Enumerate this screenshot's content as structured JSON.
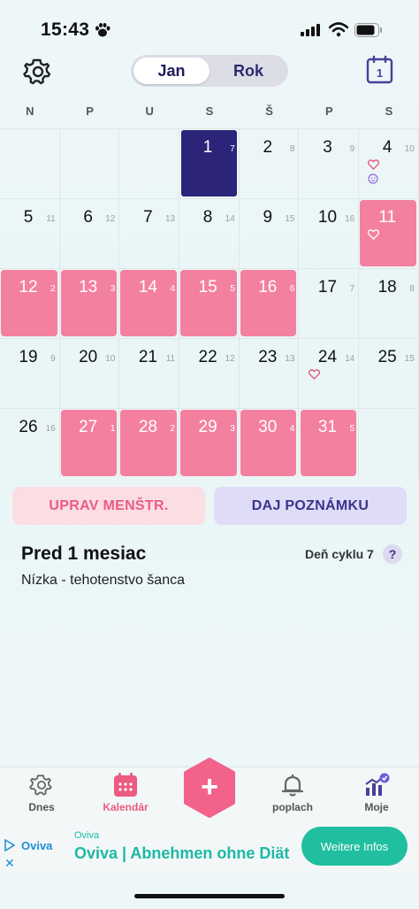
{
  "status_bar": {
    "time": "15:43"
  },
  "header": {
    "segments": [
      {
        "label": "Jan",
        "active": true
      },
      {
        "label": "Rok",
        "active": false
      }
    ]
  },
  "weekdays": [
    "N",
    "P",
    "U",
    "S",
    "Š",
    "P",
    "S"
  ],
  "calendar": {
    "days": [
      {
        "day": "",
        "cycle": "",
        "kind": "empty"
      },
      {
        "day": "",
        "cycle": "",
        "kind": "empty"
      },
      {
        "day": "",
        "cycle": "",
        "kind": "empty"
      },
      {
        "day": "1",
        "cycle": "7",
        "kind": "today"
      },
      {
        "day": "2",
        "cycle": "8",
        "kind": "normal"
      },
      {
        "day": "3",
        "cycle": "9",
        "kind": "normal"
      },
      {
        "day": "4",
        "cycle": "10",
        "kind": "normal",
        "marks": [
          "heart",
          "smiley"
        ]
      },
      {
        "day": "5",
        "cycle": "11",
        "kind": "normal"
      },
      {
        "day": "6",
        "cycle": "12",
        "kind": "normal"
      },
      {
        "day": "7",
        "cycle": "13",
        "kind": "normal"
      },
      {
        "day": "8",
        "cycle": "14",
        "kind": "normal"
      },
      {
        "day": "9",
        "cycle": "15",
        "kind": "normal"
      },
      {
        "day": "10",
        "cycle": "16",
        "kind": "normal"
      },
      {
        "day": "11",
        "cycle": "",
        "kind": "period",
        "marks": [
          "heart-white"
        ]
      },
      {
        "day": "12",
        "cycle": "2",
        "kind": "period"
      },
      {
        "day": "13",
        "cycle": "3",
        "kind": "period"
      },
      {
        "day": "14",
        "cycle": "4",
        "kind": "period"
      },
      {
        "day": "15",
        "cycle": "5",
        "kind": "period"
      },
      {
        "day": "16",
        "cycle": "6",
        "kind": "period"
      },
      {
        "day": "17",
        "cycle": "7",
        "kind": "normal"
      },
      {
        "day": "18",
        "cycle": "8",
        "kind": "normal"
      },
      {
        "day": "19",
        "cycle": "9",
        "kind": "normal"
      },
      {
        "day": "20",
        "cycle": "10",
        "kind": "normal"
      },
      {
        "day": "21",
        "cycle": "11",
        "kind": "normal"
      },
      {
        "day": "22",
        "cycle": "12",
        "kind": "normal"
      },
      {
        "day": "23",
        "cycle": "13",
        "kind": "normal"
      },
      {
        "day": "24",
        "cycle": "14",
        "kind": "normal",
        "marks": [
          "heart"
        ]
      },
      {
        "day": "25",
        "cycle": "15",
        "kind": "normal"
      },
      {
        "day": "26",
        "cycle": "16",
        "kind": "normal"
      },
      {
        "day": "27",
        "cycle": "1",
        "kind": "period"
      },
      {
        "day": "28",
        "cycle": "2",
        "kind": "period"
      },
      {
        "day": "29",
        "cycle": "3",
        "kind": "period"
      },
      {
        "day": "30",
        "cycle": "4",
        "kind": "period"
      },
      {
        "day": "31",
        "cycle": "5",
        "kind": "period"
      },
      {
        "day": "",
        "cycle": "",
        "kind": "empty"
      }
    ]
  },
  "actions": {
    "edit_period": "UPRAV MENŠTR.",
    "add_note": "DAJ POZNÁMKU"
  },
  "info": {
    "title": "Pred 1 mesiac",
    "cycle_day": "Deň cyklu 7",
    "help": "?",
    "subtitle": "Nízka - tehotenstvo šanca"
  },
  "tabs": [
    {
      "label": "Dnes",
      "icon": "gear-icon"
    },
    {
      "label": "Kalendár",
      "icon": "calendar-icon",
      "active": true
    },
    {
      "label": "poplach",
      "icon": "bell-icon"
    },
    {
      "label": "Moje",
      "icon": "chart-icon"
    }
  ],
  "fab": {
    "symbol": "+"
  },
  "ad": {
    "logo": "Oviva",
    "brand": "Oviva",
    "title": "Oviva | Abnehmen ohne Diät",
    "cta": "Weitere Infos"
  },
  "colors": {
    "period": "#f4809f",
    "today": "#2b2478",
    "accent": "#ec5b80",
    "ad_green": "#1fbf9f"
  }
}
